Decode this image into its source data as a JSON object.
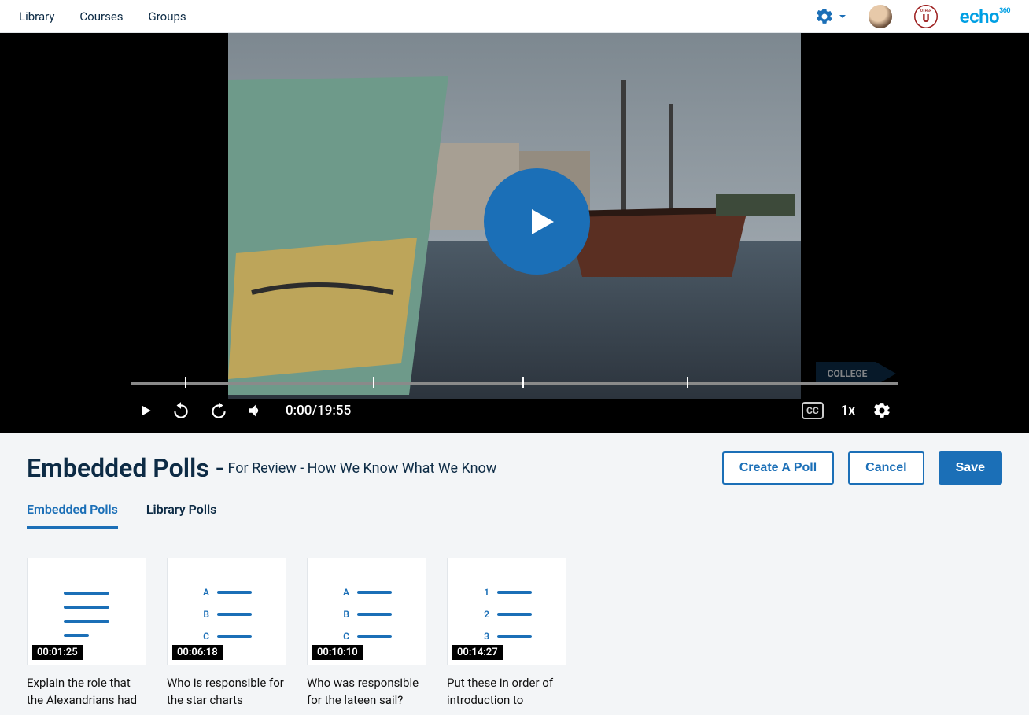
{
  "nav": {
    "library": "Library",
    "courses": "Courses",
    "groups": "Groups",
    "brand": "echo",
    "brand_sup": "360"
  },
  "video": {
    "time_readout": "0:00/19:55",
    "speed": "1x",
    "cc": "CC",
    "college_tag": "COLLEGE"
  },
  "header": {
    "title": "Embedded Polls - ",
    "subtitle": "For Review - How We Know What We Know",
    "create": "Create A Poll",
    "cancel": "Cancel",
    "save": "Save"
  },
  "tabs": {
    "embedded": "Embedded Polls",
    "library": "Library Polls"
  },
  "polls": [
    {
      "ts": "00:01:25",
      "label": "Explain the role that the Alexandrians had",
      "type": "text"
    },
    {
      "ts": "00:06:18",
      "label": "Who is responsible for the star charts",
      "type": "abc"
    },
    {
      "ts": "00:10:10",
      "label": "Who was responsible for the lateen sail?",
      "type": "abc"
    },
    {
      "ts": "00:14:27",
      "label": "Put these in order of introduction to",
      "type": "123"
    }
  ]
}
